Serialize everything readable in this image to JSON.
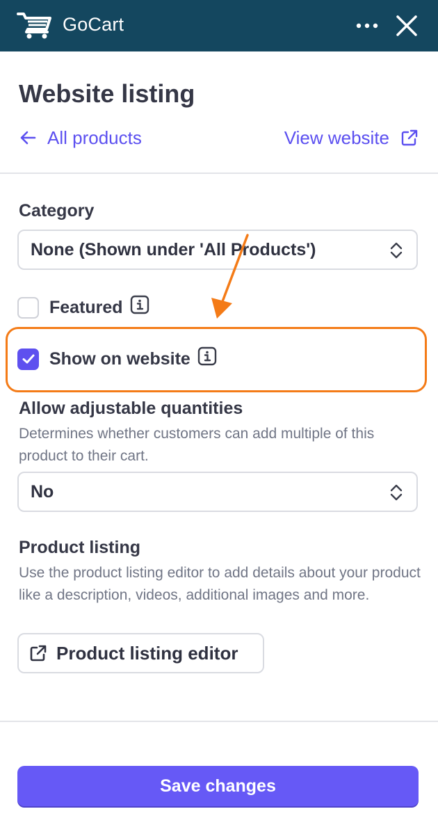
{
  "header": {
    "app_title": "GoCart",
    "icons": [
      "shopping-cart-icon",
      "more-options-icon",
      "close-icon"
    ],
    "background": "#14475f"
  },
  "page": {
    "title": "Website listing",
    "back_link": "All products",
    "view_link": "View website"
  },
  "category": {
    "label": "Category",
    "selected": "None (Shown under 'All Products')"
  },
  "checkboxes": {
    "featured": {
      "label": "Featured",
      "checked": false
    },
    "show_on_website": {
      "label": "Show on website",
      "checked": true
    }
  },
  "quantities": {
    "label": "Allow adjustable quantities",
    "help": "Determines whether customers can add multiple of this product to their cart.",
    "selected": "No"
  },
  "product_listing": {
    "label": "Product listing",
    "help": "Use the product listing editor to add details about your product like a description, videos, additional images and more.",
    "button": "Product listing editor"
  },
  "footer": {
    "save_button": "Save changes"
  },
  "colors": {
    "accent": "#5b4ff0",
    "primary_button": "#6659f6",
    "annotation": "#f47b17"
  }
}
